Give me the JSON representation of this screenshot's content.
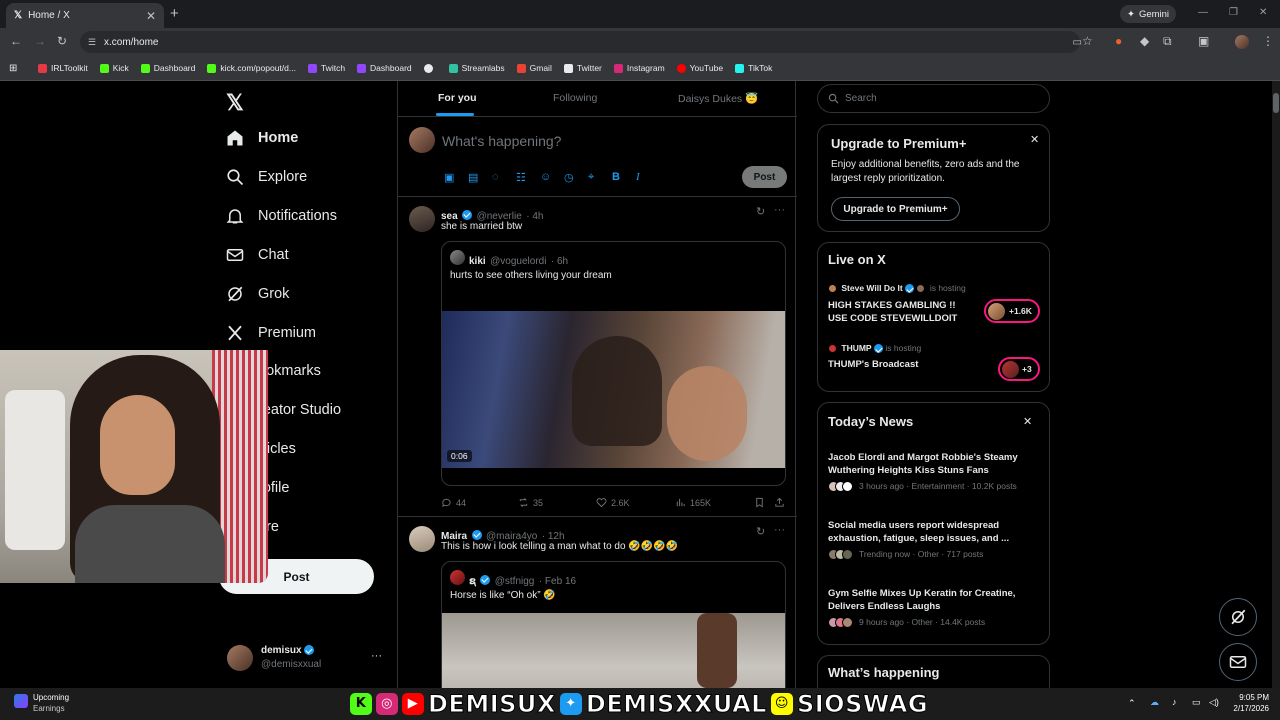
{
  "browser": {
    "tab_title": "Home / X",
    "gemini_label": "Gemini",
    "url": "x.com/home",
    "bookmarks": [
      "IRLToolkit",
      "Kick",
      "Dashboard",
      "kick.com/popout/d...",
      "Twitch",
      "Dashboard",
      "",
      "Streamlabs",
      "Gmail",
      "Twitter",
      "Instagram",
      "YouTube",
      "TikTok"
    ]
  },
  "sidebar": {
    "nav": [
      {
        "label": "Home",
        "icon": "home-icon"
      },
      {
        "label": "Explore",
        "icon": "search-icon"
      },
      {
        "label": "Notifications",
        "icon": "bell-icon"
      },
      {
        "label": "Chat",
        "icon": "mail-icon"
      },
      {
        "label": "Grok",
        "icon": "grok-icon"
      },
      {
        "label": "Premium",
        "icon": "x-icon"
      },
      {
        "label": "ookmarks",
        "icon": ""
      },
      {
        "label": "reator Studio",
        "icon": ""
      },
      {
        "label": "rticles",
        "icon": ""
      },
      {
        "label": "rofile",
        "icon": ""
      },
      {
        "label": "ore",
        "icon": ""
      }
    ],
    "post_label": "Post",
    "account": {
      "name": "demisux",
      "handle": "@demisxxual",
      "more": "···"
    }
  },
  "feed": {
    "tabs": [
      "For you",
      "Following",
      "Daisys Dukes 😇"
    ],
    "compose_placeholder": "What's happening?",
    "compose_post": "Post",
    "tweets": [
      {
        "name": "sea",
        "handle": "@neverlie",
        "time": "· 4h",
        "text": "she is married btw",
        "quote": {
          "name": "kiki",
          "handle": "@voguelordi",
          "time": "· 6h",
          "text": "hurts to see others living your dream",
          "video_time": "0:06"
        },
        "replies": "44",
        "reposts": "35",
        "likes": "2.6K",
        "views": "165K"
      },
      {
        "name": "Maira",
        "handle": "@maira4yo",
        "time": "· 12h",
        "text": "This is how i look telling a man what to do 🤣🤣🤣🤣",
        "quote": {
          "name": "ຊ",
          "handle": "@stfnigg",
          "time": "· Feb 16",
          "text": "Horse is like “Oh ok” 🤣"
        }
      }
    ]
  },
  "right": {
    "search_placeholder": "Search",
    "premium": {
      "title": "Upgrade to Premium+",
      "body": "Enjoy additional benefits, zero ads and the largest reply prioritization.",
      "button": "Upgrade to Premium+"
    },
    "live": {
      "title": "Live on X",
      "items": [
        {
          "host": "Steve Will Do It",
          "status": "is hosting",
          "title": "HIGH STAKES GAMBLING !! USE CODE STEVEWILLDOIT",
          "count": "+1.6K"
        },
        {
          "host": "THUMP",
          "status": "is hosting",
          "title": "THUMP's Broadcast",
          "count": "+3"
        }
      ]
    },
    "news": {
      "title": "Today’s News",
      "items": [
        {
          "headline": "Jacob Elordi and Margot Robbie's Steamy Wuthering Heights Kiss Stuns Fans",
          "meta": "3 hours ago · Entertainment · 10.2K posts"
        },
        {
          "headline": "Social media users report widespread exhaustion, fatigue, sleep issues, and ...",
          "meta": "Trending now · Other · 717 posts"
        },
        {
          "headline": "Gym Selfie Mixes Up Keratin for Creatine, Delivers Endless Laughs",
          "meta": "9 hours ago · Other · 14.4K posts"
        }
      ]
    },
    "happening_title": "What’s happening"
  },
  "taskbar": {
    "widget_title": "Upcoming",
    "widget_sub": "Earnings",
    "time": "9:05 PM",
    "date": "2/17/2026"
  },
  "overlay": {
    "banner": [
      "DEMISUX",
      "DEMISXXUAL",
      "SIOSWAG"
    ]
  },
  "colors": {
    "accent": "#1d9bf0",
    "background": "#000000",
    "border": "#2f3336",
    "muted": "#71767b",
    "live_ring": "#f91880"
  }
}
